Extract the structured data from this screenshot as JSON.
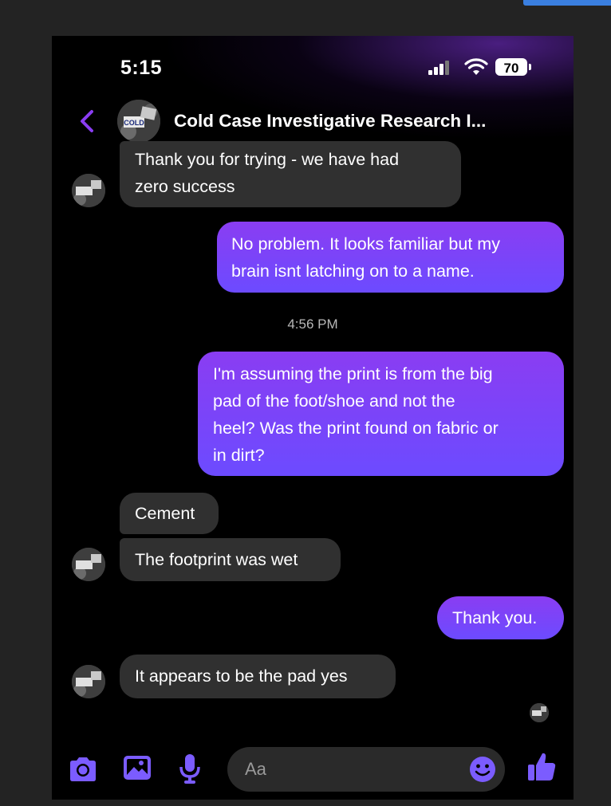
{
  "status_bar": {
    "time": "5:15",
    "battery": "70"
  },
  "header": {
    "title": "Cold Case Investigative Research I...",
    "avatar_text": "COLD"
  },
  "messages": [
    {
      "direction": "incoming",
      "lines": "Thank you for trying - we have had\nzero success"
    },
    {
      "direction": "outgoing",
      "lines": "No problem. It looks familiar but my\nbrain isnt latching on to a name."
    },
    {
      "direction": "outgoing",
      "lines": "I'm assuming the print is from the big\npad of the foot/shoe and not the\nheel? Was the print found on fabric or\nin dirt?"
    },
    {
      "direction": "incoming",
      "lines": "Cement"
    },
    {
      "direction": "incoming",
      "lines": "The footprint was wet"
    },
    {
      "direction": "outgoing",
      "lines": "Thank you."
    },
    {
      "direction": "incoming",
      "lines": "It appears to be the pad yes"
    }
  ],
  "timestamp": "4:56 PM",
  "composer": {
    "placeholder": "Aa"
  },
  "colors": {
    "accent": "#7b5cff",
    "purple": "#8a3df2",
    "incoming_bubble": "#303030"
  }
}
